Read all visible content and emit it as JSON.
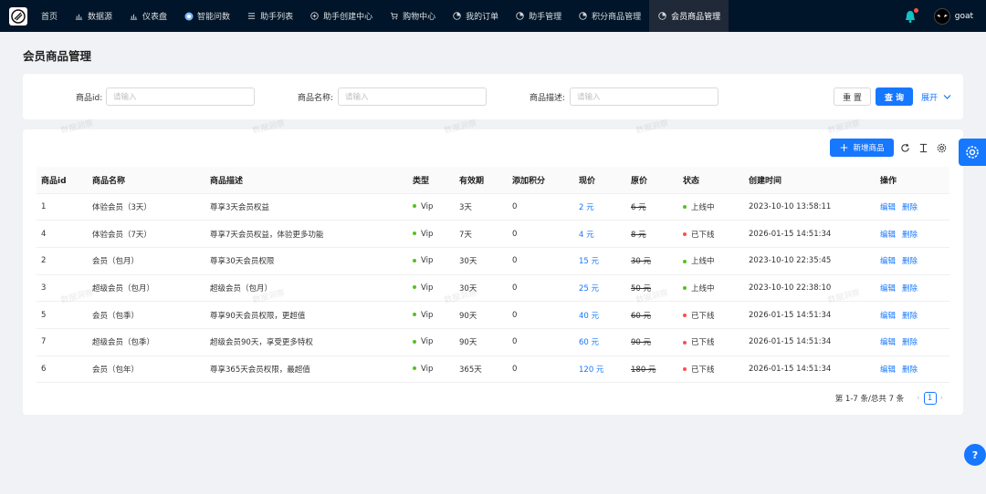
{
  "nav": {
    "items": [
      {
        "label": "首页",
        "icon": ""
      },
      {
        "label": "数据源",
        "icon": "bar-chart-icon"
      },
      {
        "label": "仪表盘",
        "icon": "bar-chart-icon"
      },
      {
        "label": "智能问数",
        "icon": "ai-icon"
      },
      {
        "label": "助手列表",
        "icon": "list-icon"
      },
      {
        "label": "助手创建中心",
        "icon": "plus-circle-icon"
      },
      {
        "label": "购物中心",
        "icon": "cart-icon"
      },
      {
        "label": "我的订单",
        "icon": "pie-icon"
      },
      {
        "label": "助手管理",
        "icon": "pie-icon"
      },
      {
        "label": "积分商品管理",
        "icon": "pie-icon"
      },
      {
        "label": "会员商品管理",
        "icon": "pie-icon"
      }
    ],
    "user": "goat"
  },
  "page": {
    "title": "会员商品管理"
  },
  "search": {
    "id_label": "商品id:",
    "name_label": "商品名称:",
    "desc_label": "商品描述:",
    "placeholder": "请输入",
    "reset": "重 置",
    "query": "查 询",
    "expand": "展开"
  },
  "toolbar": {
    "add": "新增商品"
  },
  "table": {
    "headers": [
      "商品id",
      "商品名称",
      "商品描述",
      "类型",
      "有效期",
      "添加积分",
      "现价",
      "原价",
      "状态",
      "创建时间",
      "操作"
    ],
    "rows": [
      {
        "id": "1",
        "name": "体验会员（3天）",
        "desc": "尊享3天会员权益",
        "type": "Vip",
        "period": "3天",
        "points": "0",
        "price": "2 元",
        "orig": "6 元",
        "status": "上线中",
        "online": true,
        "created": "2023-10-10 13:58:11"
      },
      {
        "id": "4",
        "name": "体验会员（7天）",
        "desc": "尊享7天会员权益，体验更多功能",
        "type": "Vip",
        "period": "7天",
        "points": "0",
        "price": "4 元",
        "orig": "8 元",
        "status": "已下线",
        "online": false,
        "created": "2026-01-15 14:51:34"
      },
      {
        "id": "2",
        "name": "会员（包月）",
        "desc": "尊享30天会员权限",
        "type": "Vip",
        "period": "30天",
        "points": "0",
        "price": "15 元",
        "orig": "30 元",
        "status": "上线中",
        "online": true,
        "created": "2023-10-10 22:35:45"
      },
      {
        "id": "3",
        "name": "超级会员（包月）",
        "desc": "超级会员（包月）",
        "type": "Vip",
        "period": "30天",
        "points": "0",
        "price": "25 元",
        "orig": "50 元",
        "status": "上线中",
        "online": true,
        "created": "2023-10-10 22:38:10"
      },
      {
        "id": "5",
        "name": "会员（包季）",
        "desc": "尊享90天会员权限，更超值",
        "type": "Vip",
        "period": "90天",
        "points": "0",
        "price": "40 元",
        "orig": "60 元",
        "status": "已下线",
        "online": false,
        "created": "2026-01-15 14:51:34"
      },
      {
        "id": "7",
        "name": "超级会员（包季）",
        "desc": "超级会员90天，享受更多特权",
        "type": "Vip",
        "period": "90天",
        "points": "0",
        "price": "60 元",
        "orig": "90 元",
        "status": "已下线",
        "online": false,
        "created": "2026-01-15 14:51:34"
      },
      {
        "id": "6",
        "name": "会员（包年）",
        "desc": "尊享365天会员权限，最超值",
        "type": "Vip",
        "period": "365天",
        "points": "0",
        "price": "120 元",
        "orig": "180 元",
        "status": "已下线",
        "online": false,
        "created": "2026-01-15 14:51:34"
      }
    ],
    "edit": "编辑",
    "delete": "删除"
  },
  "pagination": {
    "info": "第 1-7 条/总共 7 条",
    "current": "1"
  },
  "watermark": "数据洞察",
  "colors": {
    "primary": "#1677ff",
    "online": "#52c41a",
    "offline": "#ff4d4f",
    "nav_bg": "#001529"
  }
}
